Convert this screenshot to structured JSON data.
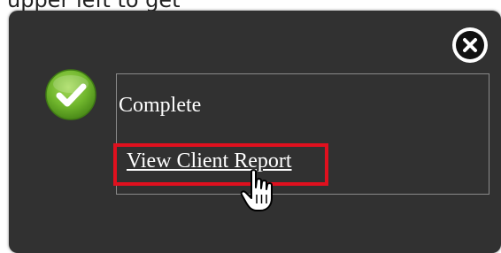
{
  "background_text": "upper left to get",
  "dialog": {
    "status": "Complete",
    "link_label": "View Client Report"
  },
  "icons": {
    "success": "check-circle-icon",
    "close": "close-icon",
    "cursor": "hand-pointer-cursor-icon"
  },
  "colors": {
    "dialog_bg": "#313131",
    "check_green": "#6fb52c",
    "highlight_red": "#e0101e"
  }
}
